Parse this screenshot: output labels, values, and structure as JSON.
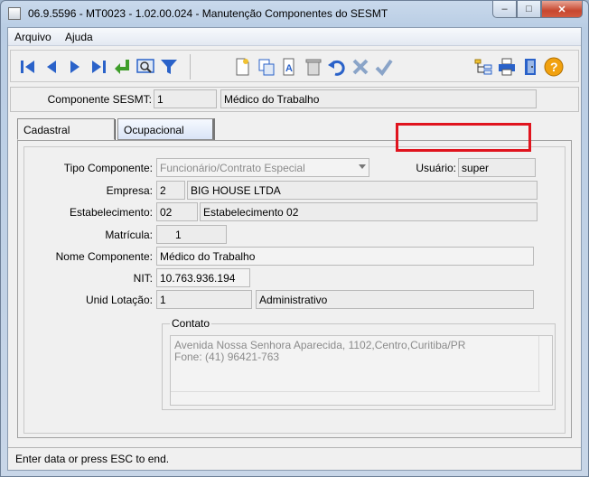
{
  "window": {
    "title": "06.9.5596 - MT0023 - 1.02.00.024 - Manutenção Componentes do SESMT",
    "min_glyph": "–",
    "max_glyph": "□",
    "close_glyph": "✕"
  },
  "menu": {
    "items": [
      "Arquivo",
      "Ajuda"
    ]
  },
  "toolbar": {
    "icons": [
      "first-record-icon",
      "previous-record-icon",
      "next-record-icon",
      "last-record-icon",
      "goto-icon",
      "search-icon",
      "filter-icon",
      "new-record-icon",
      "copy-record-icon",
      "edit-record-icon",
      "delete-record-icon",
      "undo-icon",
      "cancel-icon",
      "confirm-icon",
      "tree-icon",
      "print-icon",
      "exit-icon",
      "help-icon"
    ],
    "help_glyph": "?"
  },
  "header": {
    "componente_label": "Componente SESMT:",
    "componente_code": "1",
    "componente_desc": "Médico do Trabalho"
  },
  "tabs": [
    "Cadastral",
    "Ocupacional"
  ],
  "form": {
    "tipo_label": "Tipo Componente:",
    "tipo_value": "Funcionário/Contrato Especial",
    "usuario_label": "Usuário:",
    "usuario_value": "super",
    "empresa_label": "Empresa:",
    "empresa_code": "2",
    "empresa_name": "BIG HOUSE LTDA",
    "estab_label": "Estabelecimento:",
    "estab_code": "02",
    "estab_name": "Estabelecimento 02",
    "matricula_label": "Matrícula:",
    "matricula_value": "1",
    "nome_label": "Nome Componente:",
    "nome_value": "Médico do Trabalho",
    "nit_label": "NIT:",
    "nit_value": "10.763.936.194",
    "lotacao_label": "Unid Lotação:",
    "lotacao_code": "1",
    "lotacao_name": "Administrativo",
    "contato_legend": "Contato",
    "contato_line1": "Avenida Nossa Senhora Aparecida, 1102,Centro,Curitiba/PR",
    "contato_line2": "Fone: (41) 96421-763"
  },
  "status": {
    "text": "Enter data or press ESC to end."
  },
  "colors": {
    "highlight": "#e0141e",
    "toolbar_blue": "#2a62c9",
    "toolbar_green": "#3f9e2a"
  }
}
